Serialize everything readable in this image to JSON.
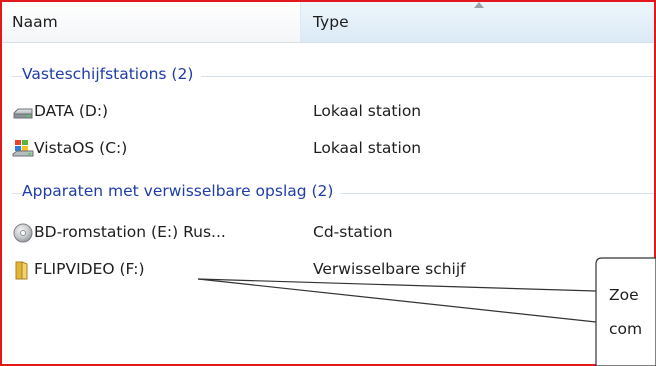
{
  "columns": {
    "name": "Naam",
    "type": "Type"
  },
  "groups": [
    {
      "label": "Vasteschijfstations (2)",
      "items": [
        {
          "name": "DATA (D:)",
          "type": "Lokaal station",
          "icon": "drive-icon"
        },
        {
          "name": "VistaOS (C:)",
          "type": "Lokaal station",
          "icon": "windows-drive-icon"
        }
      ]
    },
    {
      "label": "Apparaten met verwisselbare opslag (2)",
      "items": [
        {
          "name": "BD-romstation (E:) Rus...",
          "type": "Cd-station",
          "icon": "disc-icon"
        },
        {
          "name": "FLIPVIDEO (F:)",
          "type": "Verwisselbare schijf",
          "icon": "folder-icon"
        }
      ]
    }
  ],
  "callout": {
    "line1": "Zoe",
    "line2": "com"
  },
  "colors": {
    "frame": "#e3181d",
    "group_text": "#1e3ea7",
    "header_sorted_bg": "#dbeaf6"
  }
}
